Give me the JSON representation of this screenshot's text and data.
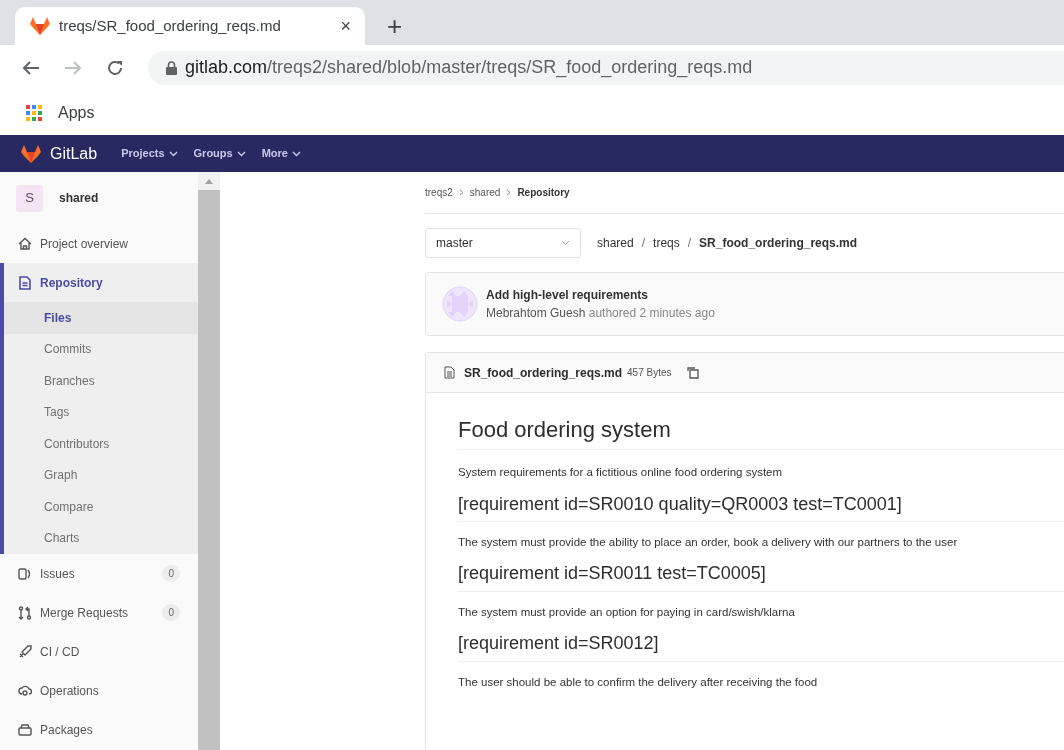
{
  "browser": {
    "tab": {
      "title": "treqs/SR_food_ordering_reqs.md",
      "selected": true,
      "close": "×"
    },
    "new_tab": "+",
    "address": {
      "host": "gitlab.com",
      "path": "/treqs2/shared/blob/master/treqs/SR_food_ordering_reqs.md"
    },
    "bookmarks": [
      "Apps"
    ]
  },
  "navbar": {
    "brand": "GitLab",
    "menus": [
      "Projects",
      "Groups",
      "More"
    ]
  },
  "sidebar": {
    "project": {
      "initial": "S",
      "name": "shared"
    },
    "items": [
      {
        "label": "Project overview",
        "selected": false
      },
      {
        "label": "Repository",
        "selected": true,
        "children": [
          {
            "label": "Files",
            "selected": true
          },
          {
            "label": "Commits",
            "selected": false
          },
          {
            "label": "Branches",
            "selected": false
          },
          {
            "label": "Tags",
            "selected": false
          },
          {
            "label": "Contributors",
            "selected": false
          },
          {
            "label": "Graph",
            "selected": false
          },
          {
            "label": "Compare",
            "selected": false
          },
          {
            "label": "Charts",
            "selected": false
          }
        ]
      },
      {
        "label": "Issues",
        "selected": false,
        "count": "0"
      },
      {
        "label": "Merge Requests",
        "selected": false,
        "count": "0"
      },
      {
        "label": "CI / CD",
        "selected": false
      },
      {
        "label": "Operations",
        "selected": false
      },
      {
        "label": "Packages",
        "selected": false
      }
    ]
  },
  "breadcrumbs": [
    "treqs2",
    "shared",
    "Repository"
  ],
  "branch": {
    "value": "master"
  },
  "path": [
    "shared",
    "treqs",
    "SR_food_ordering_reqs.md"
  ],
  "path_separator": "/",
  "commit": {
    "title": "Add high-level requirements",
    "author": "Mebrahtom Guesh",
    "meta": "authored 2 minutes ago"
  },
  "file": {
    "name": "SR_food_ordering_reqs.md",
    "size": "457 Bytes"
  },
  "content": [
    {
      "kind": "h1",
      "text": "Food ordering system"
    },
    {
      "kind": "p",
      "text": "System requirements for a fictitious online food ordering system"
    },
    {
      "kind": "h2",
      "text": "[requirement id=SR0010 quality=QR0003 test=TC0001]"
    },
    {
      "kind": "p",
      "text": "The system must provide the ability to place an order, book a delivery with our partners to the user"
    },
    {
      "kind": "h2",
      "text": "[requirement id=SR0011 test=TC0005]"
    },
    {
      "kind": "p",
      "text": "The system must provide an option for paying in card/swish/klarna"
    },
    {
      "kind": "h2",
      "text": "[requirement id=SR0012]"
    },
    {
      "kind": "p",
      "text": "The user should be able to confirm the delivery after receiving the food"
    }
  ]
}
